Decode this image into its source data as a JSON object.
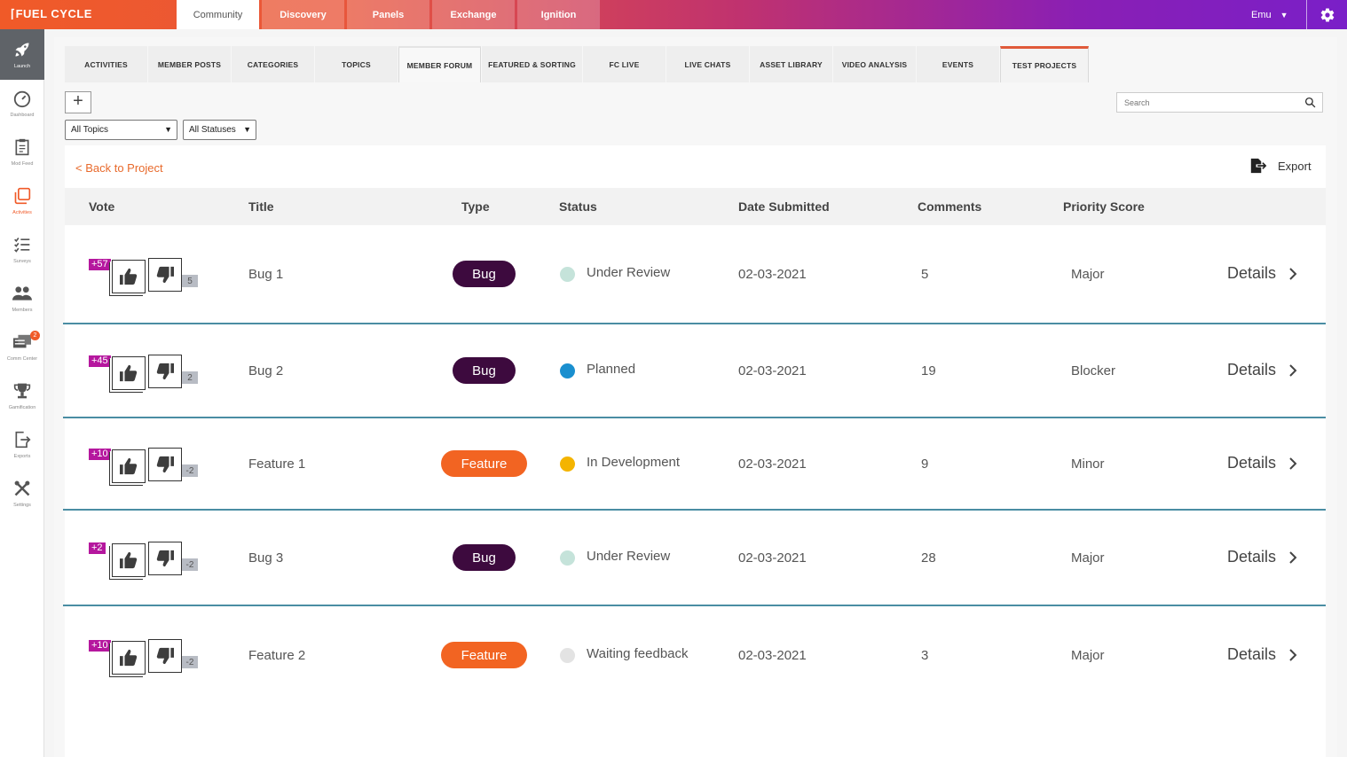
{
  "brand": {
    "logo": "FUEL CYCLE"
  },
  "topnav": [
    {
      "label": "Community",
      "active": true
    },
    {
      "label": "Discovery"
    },
    {
      "label": "Panels"
    },
    {
      "label": "Exchange"
    },
    {
      "label": "Ignition"
    }
  ],
  "user": {
    "name": "Emu"
  },
  "sidebar": [
    {
      "label": "Launch",
      "icon": "rocket-icon"
    },
    {
      "label": "Dashboard",
      "icon": "speedometer-icon"
    },
    {
      "label": "Mod Feed",
      "icon": "clipboard-icon"
    },
    {
      "label": "Activities",
      "icon": "activities-icon"
    },
    {
      "label": "Surveys",
      "icon": "checklist-icon"
    },
    {
      "label": "Members",
      "icon": "members-icon"
    },
    {
      "label": "Comm Center",
      "icon": "comm-center-icon",
      "badge": "2"
    },
    {
      "label": "Gamification",
      "icon": "trophy-icon"
    },
    {
      "label": "Exports",
      "icon": "export-icon"
    },
    {
      "label": "Settings",
      "icon": "tools-icon"
    }
  ],
  "subtabs": [
    "ACTIVITIES",
    "MEMBER POSTS",
    "CATEGORIES",
    "TOPICS",
    "MEMBER FORUM",
    "FEATURED & SORTING",
    "FC LIVE",
    "LIVE CHATS",
    "ASSET LIBRARY",
    "VIDEO ANALYSIS",
    "EVENTS",
    "TEST PROJECTS"
  ],
  "search": {
    "placeholder": "Search"
  },
  "filters": {
    "topics": "All Topics",
    "statuses": "All Statuses"
  },
  "back_link": "< Back to Project",
  "export_label": "Export",
  "table": {
    "headers": [
      "Vote",
      "Title",
      "Type",
      "Status",
      "Date Submitted",
      "Comments",
      "Priority Score"
    ],
    "rows": [
      {
        "vote": "+57",
        "down": "5",
        "title": "Bug 1",
        "type": "Bug",
        "status": "Under Review",
        "date": "02-03-2021",
        "comments": "5",
        "priority": "Major",
        "details": "Details"
      },
      {
        "vote": "+45",
        "down": "2",
        "title": "Bug 2",
        "type": "Bug",
        "status": "Planned",
        "date": "02-03-2021",
        "comments": "19",
        "priority": "Blocker",
        "details": "Details"
      },
      {
        "vote": "+10",
        "down": "-2",
        "title": "Feature 1",
        "type": "Feature",
        "status": "In Development",
        "date": "02-03-2021",
        "comments": "9",
        "priority": "Minor",
        "details": "Details"
      },
      {
        "vote": "+2",
        "down": "-2",
        "title": "Bug 3",
        "type": "Bug",
        "status": "Under Review",
        "date": "02-03-2021",
        "comments": "28",
        "priority": "Major",
        "details": "Details"
      },
      {
        "vote": "+10",
        "down": "-2",
        "title": "Feature 2",
        "type": "Feature",
        "status": "Waiting feedback",
        "date": "02-03-2021",
        "comments": "3",
        "priority": "Major",
        "details": "Details"
      }
    ]
  },
  "colors": {
    "brand_orange": "#f05a28",
    "bug_pill": "#3d0a3e",
    "feature_pill": "#f26422",
    "status_under_review": "#c5e3da",
    "status_planned": "#1a8fcf",
    "status_in_development": "#f4b400",
    "status_waiting_feedback": "#e3e3e3",
    "vote_badge": "#b5179e"
  }
}
